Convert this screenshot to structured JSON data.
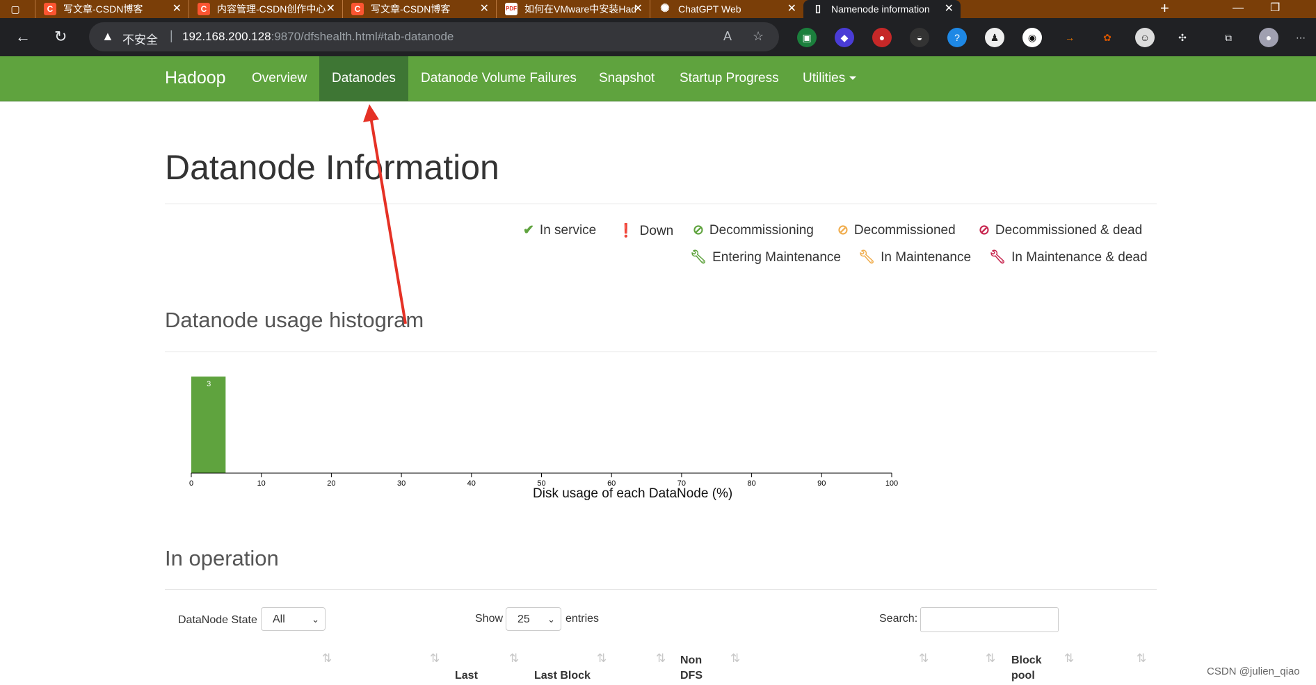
{
  "browser": {
    "tabs": [
      {
        "icon": "csdn-icon",
        "title": "写文章-CSDN博客"
      },
      {
        "icon": "csdn-icon",
        "title": "内容管理-CSDN创作中心"
      },
      {
        "icon": "csdn-icon",
        "title": "写文章-CSDN博客"
      },
      {
        "icon": "pdf-icon",
        "title": "如何在VMware中安装Hadoo"
      },
      {
        "icon": "chatgpt-icon",
        "title": "ChatGPT Web"
      },
      {
        "icon": "document-icon",
        "title": "Namenode information"
      }
    ],
    "address": {
      "insecure_label": "不安全",
      "separator": "|",
      "host": "192.168.200.128",
      "path": ":9870/dfshealth.html#tab-datanode"
    }
  },
  "nav": {
    "brand": "Hadoop",
    "items": [
      "Overview",
      "Datanodes",
      "Datanode Volume Failures",
      "Snapshot",
      "Startup Progress",
      "Utilities"
    ],
    "active": "Datanodes"
  },
  "page": {
    "title": "Datanode Information",
    "legend": [
      {
        "label": "In service",
        "icon": "check-icon",
        "color": "#5fa33e"
      },
      {
        "label": "Down",
        "icon": "exclamation-circle-icon",
        "color": "#c7254e"
      },
      {
        "label": "Decommissioning",
        "icon": "ban-icon",
        "color": "#5fa33e"
      },
      {
        "label": "Decommissioned",
        "icon": "ban-icon",
        "color": "#f0ad4e"
      },
      {
        "label": "Decommissioned & dead",
        "icon": "ban-icon",
        "color": "#c7254e"
      },
      {
        "label": "Entering Maintenance",
        "icon": "wrench-icon",
        "color": "#5fa33e"
      },
      {
        "label": "In Maintenance",
        "icon": "wrench-icon",
        "color": "#f0ad4e"
      },
      {
        "label": "In Maintenance & dead",
        "icon": "wrench-icon",
        "color": "#c7254e"
      }
    ],
    "histogram_heading": "Datanode usage histogram",
    "operation_heading": "In operation"
  },
  "chart_data": {
    "type": "bar",
    "title": "",
    "xlabel": "Disk usage of each DataNode (%)",
    "ylabel": "",
    "x_ticks": [
      0,
      10,
      20,
      30,
      40,
      50,
      60,
      70,
      80,
      90,
      100
    ],
    "xlim": [
      0,
      100
    ],
    "bins": [
      {
        "from": 0,
        "to": 5,
        "count": 3
      }
    ],
    "bar_color": "#5fa33e"
  },
  "table_controls": {
    "state_label": "DataNode State",
    "state_value": "All",
    "show_label": "Show",
    "page_size": "25",
    "entries_label": "entries",
    "search_label": "Search:"
  },
  "table_headers": [
    "Last",
    "Last Block",
    "Non DFS",
    "Block pool"
  ],
  "watermark": "CSDN @julien_qiao"
}
